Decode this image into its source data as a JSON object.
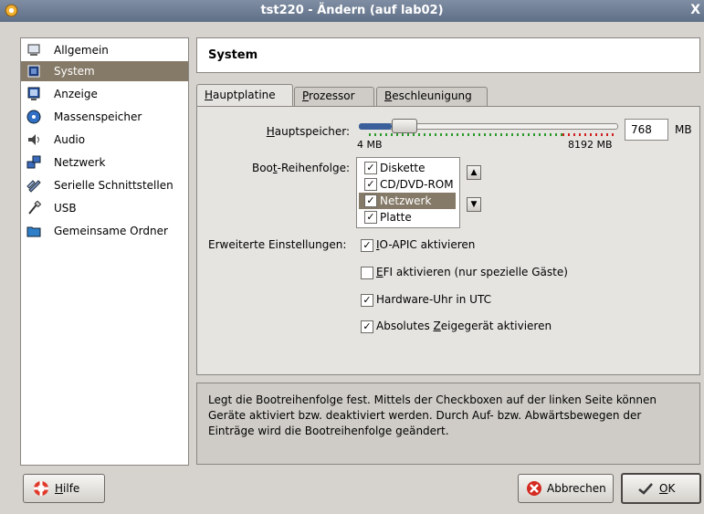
{
  "window": {
    "title": "tst220 - Ändern (auf lab02)",
    "close": "X"
  },
  "sidebar": {
    "items": [
      {
        "label": "Allgemein",
        "icon": "monitor-icon"
      },
      {
        "label": "System",
        "icon": "chip-icon"
      },
      {
        "label": "Anzeige",
        "icon": "display-icon"
      },
      {
        "label": "Massenspeicher",
        "icon": "disk-icon"
      },
      {
        "label": "Audio",
        "icon": "speaker-icon"
      },
      {
        "label": "Netzwerk",
        "icon": "network-icon"
      },
      {
        "label": "Serielle Schnittstellen",
        "icon": "serial-icon"
      },
      {
        "label": "USB",
        "icon": "usb-icon"
      },
      {
        "label": "Gemeinsame Ordner",
        "icon": "folder-icon"
      }
    ],
    "selected": "System"
  },
  "header": {
    "title": "System"
  },
  "tabs": [
    {
      "label_pre": "",
      "label_u": "H",
      "label_post": "auptplatine"
    },
    {
      "label_pre": "",
      "label_u": "P",
      "label_post": "rozessor"
    },
    {
      "label_pre": "",
      "label_u": "B",
      "label_post": "eschleunigung"
    }
  ],
  "memory": {
    "label_u": "H",
    "label_post": "auptspeicher:",
    "value": "768",
    "unit": "MB",
    "min_label": "4 MB",
    "max_label": "8192 MB",
    "min": 4,
    "max": 8192,
    "current": 768
  },
  "boot": {
    "label_pre": "Boo",
    "label_u": "t",
    "label_post": "-Reihenfolge:",
    "items": [
      {
        "label": "Diskette",
        "checked": true
      },
      {
        "label": "CD/DVD-ROM",
        "checked": true
      },
      {
        "label": "Netzwerk",
        "checked": true,
        "selected": true
      },
      {
        "label": "Platte",
        "checked": true
      }
    ],
    "up_icon": "arrow-up-icon",
    "down_icon": "arrow-down-icon"
  },
  "extended": {
    "label": "Erweiterte Einstellungen:",
    "options": [
      {
        "u": "I",
        "rest": "O-APIC aktivieren",
        "pre": "",
        "checked": true
      },
      {
        "u": "E",
        "rest": "FI aktivieren (nur spezielle Gäste)",
        "pre": "",
        "checked": false
      },
      {
        "u": "",
        "rest": "Hardware-Uhr in UTC",
        "pre": "",
        "checked": true
      },
      {
        "u": "Z",
        "rest": "eigegerät aktivieren",
        "pre": "Absolutes ",
        "checked": true
      }
    ]
  },
  "info": "Legt die Bootreihenfolge fest. Mittels der Checkboxen auf der linken Seite können Geräte aktiviert bzw. deaktiviert werden. Durch Auf- bzw. Abwärtsbewegen der Einträge wird die Bootreihenfolge geändert.",
  "buttons": {
    "help": {
      "u": "H",
      "rest": "ilfe"
    },
    "cancel": "Abbrechen",
    "ok": {
      "u": "O",
      "rest": "K"
    }
  },
  "colors": {
    "selection": "#857a68",
    "titlebar": "#6f7f97",
    "slider": "#3b5f9a"
  }
}
